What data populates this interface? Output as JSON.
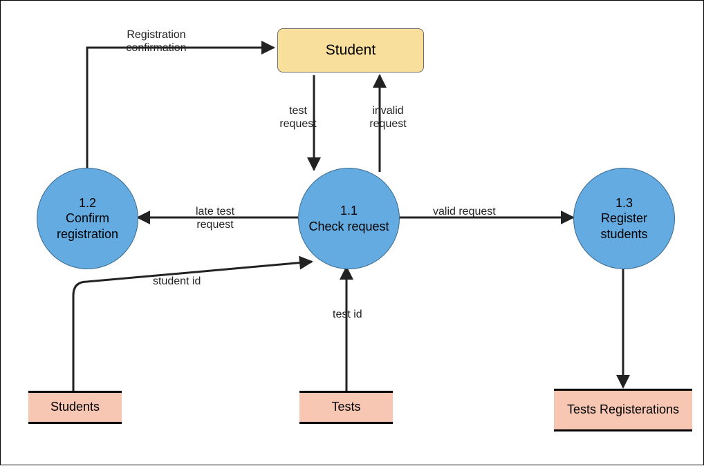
{
  "entity": {
    "student": "Student"
  },
  "processes": {
    "check": {
      "id": "1.1",
      "name": "Check request"
    },
    "confirm": {
      "id": "1.2",
      "name": "Confirm registration"
    },
    "register": {
      "id": "1.3",
      "name": "Register students"
    }
  },
  "stores": {
    "students": "Students",
    "tests": "Tests",
    "testRegs": "Tests Registerations"
  },
  "flows": {
    "regConfirmation": "Registration confirmation",
    "testRequest": "test request",
    "invalidRequest": "invalid request",
    "lateTestRequest": "late test request",
    "validRequest": "valid request",
    "studentId": "student id",
    "testId": "test id"
  }
}
